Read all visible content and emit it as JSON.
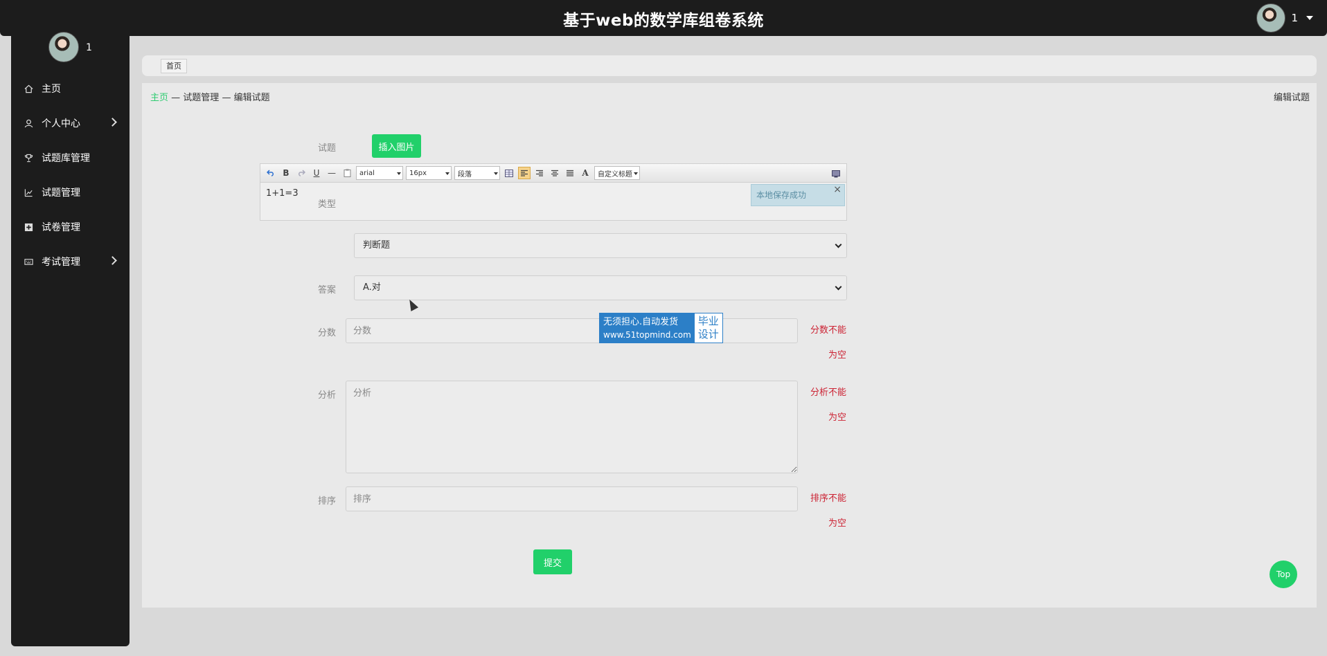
{
  "header": {
    "title": "基于web的数学库组卷系统",
    "user": "1"
  },
  "sidebar": {
    "user": "1",
    "items": [
      {
        "label": "主页",
        "icon": "home-icon",
        "has_sub": false
      },
      {
        "label": "个人中心",
        "icon": "user-icon",
        "has_sub": true
      },
      {
        "label": "试题库管理",
        "icon": "trophy-icon",
        "has_sub": false
      },
      {
        "label": "试题管理",
        "icon": "line-chart-icon",
        "has_sub": false
      },
      {
        "label": "试卷管理",
        "icon": "plus-square-icon",
        "has_sub": false
      },
      {
        "label": "考试管理",
        "icon": "keyboard-icon",
        "has_sub": true
      }
    ]
  },
  "tabs": [
    {
      "label": "首页"
    }
  ],
  "breadcrumb": {
    "home": "主页",
    "sep1": "—",
    "level1": "试题管理",
    "sep2": "—",
    "level2": "编辑试题"
  },
  "page_title": "编辑试题",
  "form": {
    "question_label": "试题",
    "insert_image_label": "插入图片",
    "editor": {
      "font": "arial",
      "size": "16px",
      "paragraph": "段落",
      "custom_title": "自定义标题",
      "content": "1+1=3",
      "toast": "本地保存成功",
      "toast_close": "×"
    },
    "type_label": "类型",
    "type_value": "判断题",
    "answer_label": "答案",
    "answer_value": "A.对",
    "score_label": "分数",
    "score_placeholder": "分数",
    "score_error_1": "分数不能",
    "score_error_2": "为空",
    "analysis_label": "分析",
    "analysis_placeholder": "分析",
    "analysis_error_1": "分析不能",
    "analysis_error_2": "为空",
    "order_label": "排序",
    "order_placeholder": "排序",
    "order_error_1": "排序不能",
    "order_error_2": "为空",
    "submit_label": "提交"
  },
  "watermark": {
    "line1": "无须担心.自动发货",
    "url": "www.51topmind.com",
    "right1": "毕业",
    "right2": "设计"
  },
  "top_button": "Top"
}
